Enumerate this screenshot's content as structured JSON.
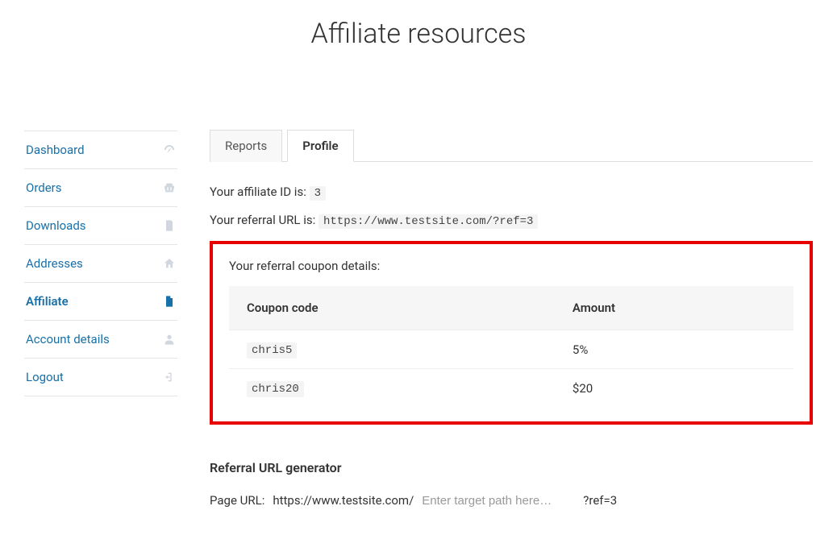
{
  "page_title": "Affiliate resources",
  "sidebar": {
    "items": [
      {
        "label": "Dashboard",
        "icon": "dashboard-icon",
        "active": false
      },
      {
        "label": "Orders",
        "icon": "basket-icon",
        "active": false
      },
      {
        "label": "Downloads",
        "icon": "file-icon",
        "active": false
      },
      {
        "label": "Addresses",
        "icon": "home-icon",
        "active": false
      },
      {
        "label": "Affiliate",
        "icon": "document-icon",
        "active": true
      },
      {
        "label": "Account details",
        "icon": "user-icon",
        "active": false
      },
      {
        "label": "Logout",
        "icon": "logout-icon",
        "active": false
      }
    ]
  },
  "tabs": [
    {
      "label": "Reports",
      "active": false
    },
    {
      "label": "Profile",
      "active": true
    }
  ],
  "affiliate_id_label": "Your affiliate ID is:",
  "affiliate_id": "3",
  "referral_url_label": "Your referral URL is:",
  "referral_url": "https://www.testsite.com/?ref=3",
  "coupon_section_label": "Your referral coupon details:",
  "coupon_table": {
    "headers": {
      "code": "Coupon code",
      "amount": "Amount"
    },
    "rows": [
      {
        "code": "chris5",
        "amount": "5%"
      },
      {
        "code": "chris20",
        "amount": "$20"
      }
    ]
  },
  "url_generator": {
    "heading": "Referral URL generator",
    "prefix_label": "Page URL:",
    "base_url": "https://www.testsite.com/",
    "placeholder": "Enter target path here…",
    "suffix": "?ref=3"
  }
}
